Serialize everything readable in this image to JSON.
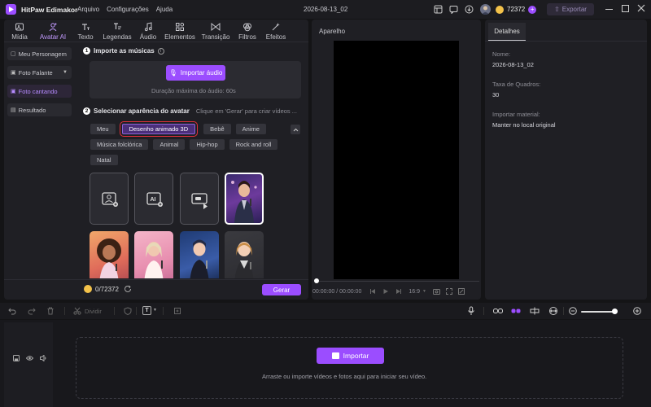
{
  "titlebar": {
    "app_name": "HitPaw Edimakor",
    "menu": [
      "Arquivo",
      "Configurações",
      "Ajuda"
    ],
    "project_date": "2026-08-13_02",
    "credits": "72372",
    "export_label": "Exportar"
  },
  "toolbar": {
    "tabs": [
      {
        "label": "Mídia",
        "icon": "media-icon"
      },
      {
        "label": "Avatar AI",
        "icon": "avatar-ai-icon"
      },
      {
        "label": "Texto",
        "icon": "text-icon"
      },
      {
        "label": "Legendas",
        "icon": "captions-icon"
      },
      {
        "label": "Áudio",
        "icon": "audio-icon"
      },
      {
        "label": "Elementos",
        "icon": "elements-icon"
      },
      {
        "label": "Transição",
        "icon": "transition-icon"
      },
      {
        "label": "Filtros",
        "icon": "filters-icon"
      },
      {
        "label": "Efeitos",
        "icon": "effects-icon"
      }
    ],
    "active_tab": "Avatar AI"
  },
  "sidebar": {
    "items": [
      {
        "label": "Meu Personagem"
      },
      {
        "label": "Foto Falante"
      },
      {
        "label": "Foto cantando"
      },
      {
        "label": "Resultado"
      }
    ],
    "active": "Foto cantando"
  },
  "step1": {
    "number": "1",
    "title": "Importe as músicas",
    "import_button": "Importar áudio",
    "hint": "Duração máxima do áudio: 60s"
  },
  "step2": {
    "number": "2",
    "title": "Selecionar aparência do avatar",
    "hint": "Clique em 'Gerar' para criar vídeos ...",
    "chips": [
      "Meu",
      "Desenho animado 3D",
      "Bebê",
      "Anime",
      "Música folclórica",
      "Animal",
      "Hip-hop",
      "Rock and roll",
      "Natal"
    ],
    "selected_chip": "Desenho animado 3D"
  },
  "footer_left": {
    "credits": "0/72372",
    "generate_button": "Gerar"
  },
  "preview": {
    "title": "Aparelho",
    "time": "00:00:00 / 00:00:00",
    "ratio": "16:9"
  },
  "details": {
    "tab": "Detalhes",
    "fields": [
      {
        "label": "Nome:",
        "value": "2026-08-13_02"
      },
      {
        "label": "Taxa de Quadros:",
        "value": "30"
      },
      {
        "label": "Importar material:",
        "value": "Manter no local original"
      }
    ]
  },
  "timeline": {
    "split_label": "Dividir",
    "import_button": "Importar",
    "hint": "Arraste ou importe vídeos e fotos aqui para iniciar seu vídeo."
  },
  "colors": {
    "accent": "#9b4dff",
    "background": "#141416",
    "panel": "#1f1f24",
    "highlight_border": "#e0303a"
  }
}
